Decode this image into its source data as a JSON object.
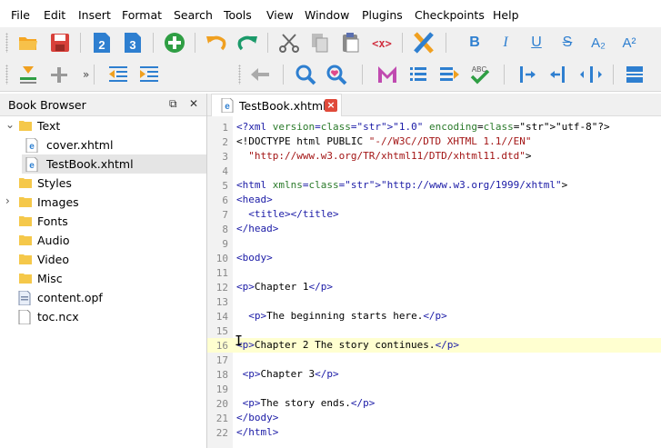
{
  "menu": [
    "File",
    "Edit",
    "Insert",
    "Format",
    "Search",
    "Tools",
    "View",
    "Window",
    "Plugins",
    "Checkpoints",
    "Help"
  ],
  "toolbar_icons": {
    "row1": [
      "open-folder-icon",
      "save-icon",
      "heading2-icon",
      "heading3-icon",
      "add-icon",
      "undo-icon",
      "redo-icon",
      "cut-icon",
      "copy-icon",
      "paste-icon",
      "remove-tags-icon",
      "validate-icon",
      "bold-icon",
      "italic-icon",
      "underline-icon",
      "strikethrough-icon",
      "subscript-icon",
      "superscript-icon"
    ],
    "row2": [
      "insert-file-icon",
      "insert-special-icon",
      "decrease-indent-icon",
      "increase-indent-icon",
      "back-icon",
      "find-icon",
      "find-bookmark-icon",
      "metadata-icon",
      "toc-icon",
      "generate-toc-icon",
      "spellcheck-icon",
      "split-marker-icon",
      "insert-id-icon",
      "link-icon",
      "clip-icon"
    ]
  },
  "toolbar_labels": {
    "bold": "B",
    "italic": "I",
    "underline": "U",
    "strike": "S",
    "sub": "A₂",
    "sup": "A²",
    "heading2": "2",
    "heading3": "3",
    "more": "»",
    "spell": "ABC"
  },
  "book_browser": {
    "title": "Book Browser",
    "float_btn": "⧉",
    "close_btn": "✕",
    "items": [
      {
        "label": "Text",
        "type": "folder",
        "expanded": true
      },
      {
        "label": "cover.xhtml",
        "type": "xhtml"
      },
      {
        "label": "TestBook.xhtml",
        "type": "xhtml",
        "selected": true
      },
      {
        "label": "Styles",
        "type": "folder"
      },
      {
        "label": "Images",
        "type": "folder",
        "collapsed": true
      },
      {
        "label": "Fonts",
        "type": "folder"
      },
      {
        "label": "Audio",
        "type": "folder"
      },
      {
        "label": "Video",
        "type": "folder"
      },
      {
        "label": "Misc",
        "type": "folder"
      },
      {
        "label": "content.opf",
        "type": "opf"
      },
      {
        "label": "toc.ncx",
        "type": "ncx"
      }
    ]
  },
  "editor": {
    "tab_label": "TestBook.xhtml",
    "current_line": 16,
    "lines": [
      {
        "n": "1",
        "code": "<?xml version=\"1.0\" encoding=\"utf-8\"?>"
      },
      {
        "n": "2",
        "code": "<!DOCTYPE html PUBLIC \"-//W3C//DTD XHTML 1.1//EN\""
      },
      {
        "n": "3",
        "code": "  \"http://www.w3.org/TR/xhtml11/DTD/xhtml11.dtd\">"
      },
      {
        "n": "4",
        "code": ""
      },
      {
        "n": "5",
        "code": "<html xmlns=\"http://www.w3.org/1999/xhtml\">"
      },
      {
        "n": "6",
        "code": "<head>"
      },
      {
        "n": "7",
        "code": "  <title></title>"
      },
      {
        "n": "8",
        "code": "</head>"
      },
      {
        "n": "9",
        "code": ""
      },
      {
        "n": "10",
        "code": "<body>"
      },
      {
        "n": "11",
        "code": ""
      },
      {
        "n": "12",
        "code": "<p>Chapter 1</p>"
      },
      {
        "n": "13",
        "code": ""
      },
      {
        "n": "14",
        "code": "  <p>The beginning starts here.</p>"
      },
      {
        "n": "15",
        "code": ""
      },
      {
        "n": "16",
        "code": "<p>Chapter 2 The story continues.</p>"
      },
      {
        "n": "17",
        "code": ""
      },
      {
        "n": "18",
        "code": " <p>Chapter 3</p>"
      },
      {
        "n": "19",
        "code": ""
      },
      {
        "n": "20",
        "code": " <p>The story ends.</p>"
      },
      {
        "n": "21",
        "code": "</body>"
      },
      {
        "n": "22",
        "code": "</html>"
      }
    ]
  }
}
